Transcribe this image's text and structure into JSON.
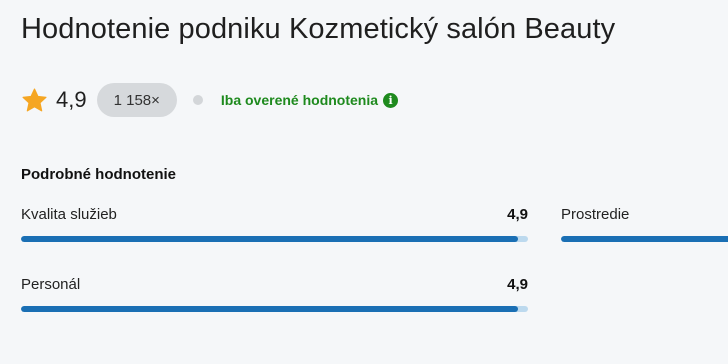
{
  "title": "Hodnotenie podniku Kozmetický salón Beauty",
  "summary": {
    "rating": "4,9",
    "count": "1 158×",
    "verified_label": "Iba overené hodnotenia",
    "info_glyph": "i",
    "star_color": "#f5a623",
    "verified_color": "#1e8a1e"
  },
  "details": {
    "heading": "Podrobné hodnotenie",
    "criteria": [
      {
        "label": "Kvalita služieb",
        "score": "4,9",
        "fraction": 0.98
      },
      {
        "label": "Prostredie",
        "score": "",
        "fraction": 1.0
      },
      {
        "label": "Personál",
        "score": "4,9",
        "fraction": 0.98
      }
    ],
    "bar_color": "#1a6fb4",
    "track_color": "#bcd9ee"
  }
}
